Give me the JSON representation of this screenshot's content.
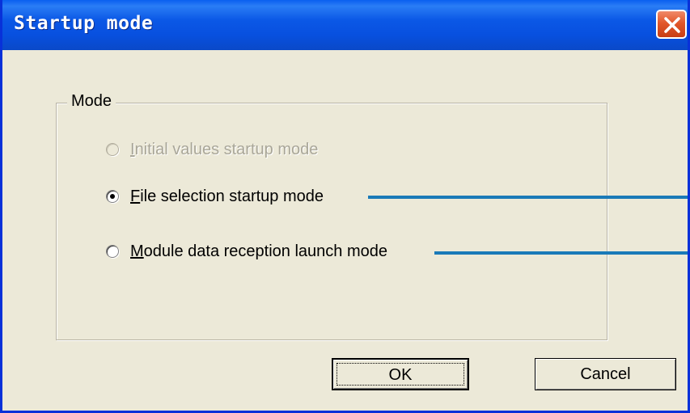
{
  "window": {
    "title": "Startup mode"
  },
  "group": {
    "label": "Mode"
  },
  "options": [
    {
      "hotkey": "I",
      "rest": "nitial values startup mode",
      "enabled": false,
      "selected": false
    },
    {
      "hotkey": "F",
      "rest": "ile selection startup mode",
      "enabled": true,
      "selected": true
    },
    {
      "hotkey": "M",
      "rest": "odule data reception launch mode",
      "enabled": true,
      "selected": false
    }
  ],
  "buttons": {
    "ok_label": "OK",
    "cancel_label": "Cancel"
  },
  "colors": {
    "titlebar": "#0a5ff0",
    "close": "#e2572a",
    "callout": "#1a7ab8",
    "dialog_bg": "#ece9d8"
  },
  "icons": {
    "close": "close-x-icon"
  }
}
